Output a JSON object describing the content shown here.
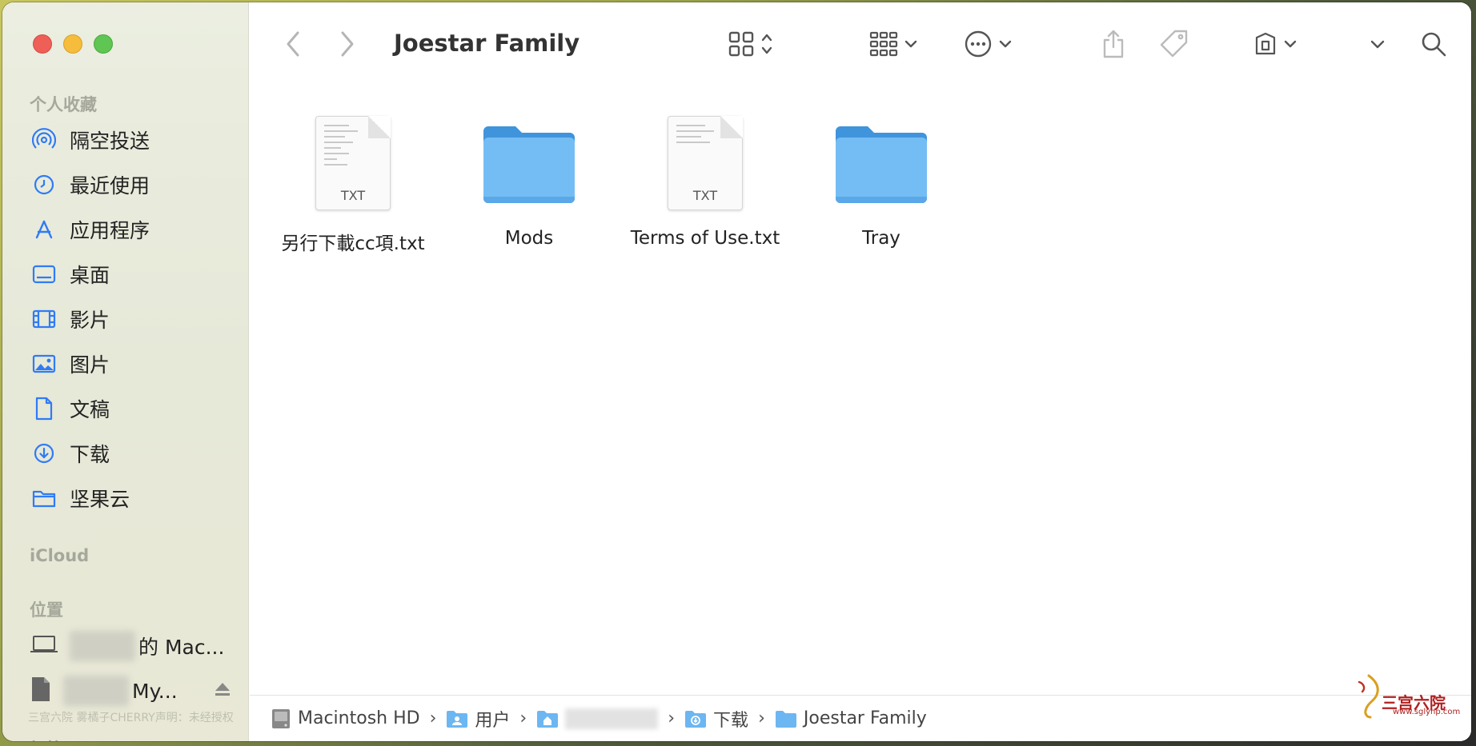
{
  "window": {
    "title": "Joestar Family"
  },
  "sidebar": {
    "favorites_title": "个人收藏",
    "favorites": [
      {
        "label": "隔空投送",
        "icon": "airdrop-icon"
      },
      {
        "label": "最近使用",
        "icon": "clock-icon"
      },
      {
        "label": "应用程序",
        "icon": "applications-icon"
      },
      {
        "label": "桌面",
        "icon": "desktop-icon"
      },
      {
        "label": "影片",
        "icon": "film-icon"
      },
      {
        "label": "图片",
        "icon": "photo-icon"
      },
      {
        "label": "文稿",
        "icon": "document-icon"
      },
      {
        "label": "下载",
        "icon": "download-icon"
      },
      {
        "label": "坚果云",
        "icon": "folder-icon"
      }
    ],
    "icloud_title": "iCloud",
    "locations_title": "位置",
    "locations": [
      {
        "label": "的 Mac...",
        "icon": "laptop-icon"
      },
      {
        "label": "My...",
        "icon": "file-icon"
      }
    ],
    "footer_text": "三宫六院 雾橘子CHERRY声明：未经授权",
    "tags_title": "标签"
  },
  "files": [
    {
      "name": "另行下載cc項.txt",
      "type": "txt",
      "ext_label": "TXT"
    },
    {
      "name": "Mods",
      "type": "folder"
    },
    {
      "name": "Terms of Use.txt",
      "type": "txt",
      "ext_label": "TXT"
    },
    {
      "name": "Tray",
      "type": "folder"
    }
  ],
  "pathbar": {
    "items": [
      "Macintosh HD",
      "用户",
      "",
      "下载",
      "Joestar Family"
    ]
  },
  "watermark": {
    "brand": "三宫六院",
    "url": "www.sglynp.com"
  },
  "colors": {
    "accent": "#2f7bf6",
    "folder": "#6cb6f2",
    "close": "#ee5f58",
    "minimize": "#f5bd3b",
    "maximize": "#5fc553"
  }
}
